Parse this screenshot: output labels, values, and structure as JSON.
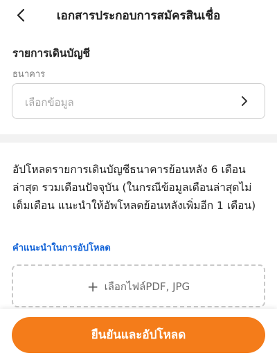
{
  "header": {
    "title": "เอกสารประกอบการสมัครสินเชื่อ",
    "back_icon": "chevron-left-icon"
  },
  "bank_section": {
    "title": "รายการเดินบัญชี",
    "bank_label": "ธนาคาร",
    "bank_placeholder": "เลือกข้อมูล",
    "chevron_icon": "chevron-right-icon"
  },
  "upload_section": {
    "description": "อัปโหลดรายการเดินบัญชีธนาคารย้อนหลัง 6 เดือนล่าสุด รวมเดือนปัจจุบัน (ในกรณีข้อมูลเดือนล่าสุดไม่เต็มเดือน แนะนำให้อัพโหลดย้อนหลังเพิ่มอีก 1 เดือน)",
    "guide_link": "คำแนะนำในการอัปโหลด",
    "file_picker_label": "เลือกไฟล์PDF, JPG",
    "file_picker_icon": "plus-icon"
  },
  "footer": {
    "confirm_label": "ยืนยันและอัปโหลด"
  },
  "colors": {
    "accent": "#f47c1a",
    "link": "#1565d8"
  }
}
